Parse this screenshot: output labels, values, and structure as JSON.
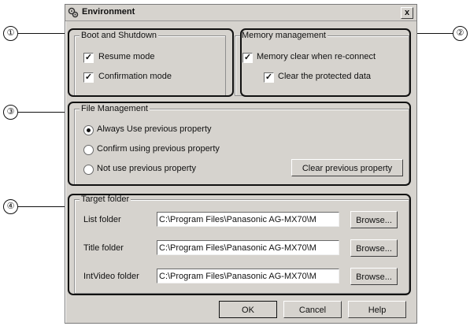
{
  "window": {
    "title": "Environment",
    "close_label": "x"
  },
  "callouts": [
    "1",
    "2",
    "3",
    "4"
  ],
  "boot": {
    "legend": "Boot and Shutdown",
    "resume_label": "Resume mode",
    "resume_checked": true,
    "confirm_label": "Confirmation mode",
    "confirm_checked": true
  },
  "memory": {
    "legend": "Memory management",
    "clear_reconnect_label": "Memory clear when re-connect",
    "clear_reconnect_checked": true,
    "clear_protected_label": "Clear the protected data",
    "clear_protected_checked": true
  },
  "file_management": {
    "legend": "File Management",
    "options": [
      "Always Use previous property",
      "Confirm using previous property",
      "Not use previous property"
    ],
    "selected": 0,
    "clear_button": "Clear previous property"
  },
  "target_folder": {
    "legend": "Target folder",
    "rows": [
      {
        "label": "List folder",
        "path": "C:\\Program Files\\Panasonic AG-MX70\\M",
        "browse": "Browse..."
      },
      {
        "label": "Title folder",
        "path": "C:\\Program Files\\Panasonic AG-MX70\\M",
        "browse": "Browse..."
      },
      {
        "label": "IntVideo folder",
        "path": "C:\\Program Files\\Panasonic AG-MX70\\M",
        "browse": "Browse..."
      }
    ]
  },
  "footer": {
    "ok": "OK",
    "cancel": "Cancel",
    "help": "Help"
  }
}
